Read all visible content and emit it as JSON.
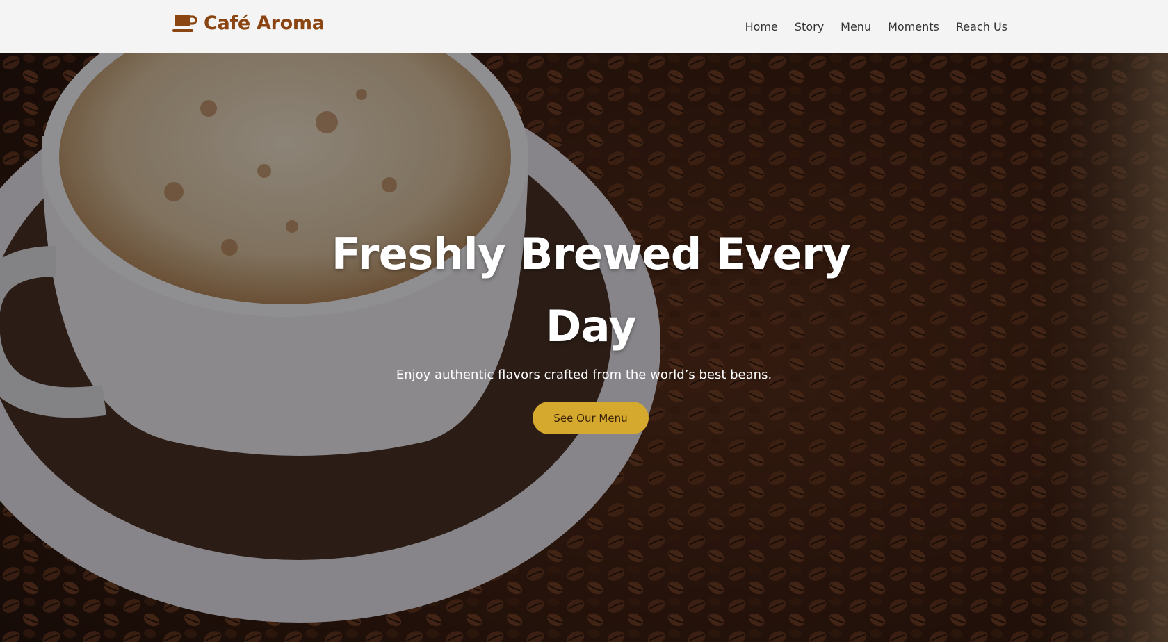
{
  "header": {
    "brand_icon": "coffee-cup-icon",
    "brand_name": "Café Aroma",
    "nav": [
      {
        "label": "Home"
      },
      {
        "label": "Story"
      },
      {
        "label": "Menu"
      },
      {
        "label": "Moments"
      },
      {
        "label": "Reach Us"
      }
    ]
  },
  "hero": {
    "background": "coffee cup and beans photo",
    "title": "Freshly Brewed Every Day",
    "subtitle": "Enjoy authentic flavors crafted from the world’s best beans.",
    "cta_label": "See Our Menu"
  },
  "colors": {
    "brand": "#8b4513",
    "accent": "#d4a92e",
    "nav_bg": "#f4f4f4",
    "nav_text": "#333333"
  }
}
